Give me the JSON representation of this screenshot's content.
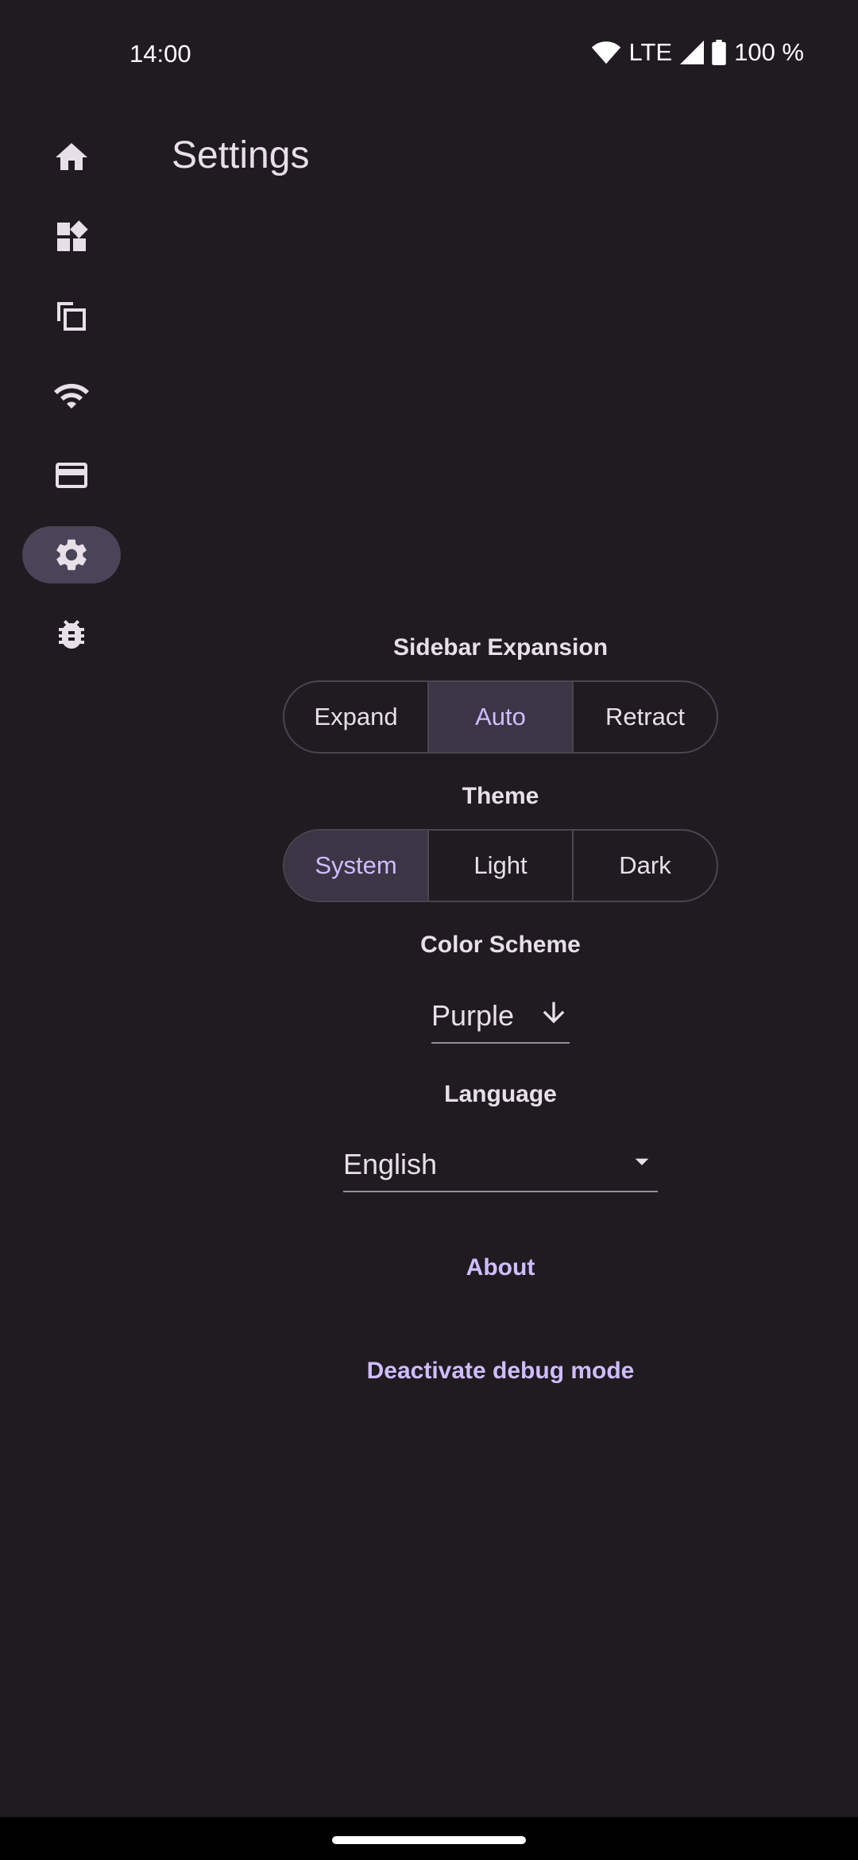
{
  "status_bar": {
    "time": "14:00",
    "network": "LTE",
    "battery": "100 %",
    "icons": [
      "wifi-icon",
      "cellular-signal-icon",
      "battery-icon"
    ]
  },
  "nav_rail": {
    "items": [
      {
        "name": "home",
        "icon": "home-icon",
        "active": false
      },
      {
        "name": "widgets",
        "icon": "widgets-icon",
        "active": false
      },
      {
        "name": "copy",
        "icon": "copy-icon",
        "active": false
      },
      {
        "name": "wifi",
        "icon": "wifi-icon",
        "active": false
      },
      {
        "name": "card",
        "icon": "credit-card-icon",
        "active": false
      },
      {
        "name": "settings",
        "icon": "gear-icon",
        "active": true
      },
      {
        "name": "debug",
        "icon": "bug-icon",
        "active": false
      }
    ]
  },
  "page": {
    "title": "Settings"
  },
  "sidebar_expansion": {
    "label": "Sidebar Expansion",
    "options": [
      "Expand",
      "Auto",
      "Retract"
    ],
    "selected": "Auto"
  },
  "theme": {
    "label": "Theme",
    "options": [
      "System",
      "Light",
      "Dark"
    ],
    "selected": "System"
  },
  "color_scheme": {
    "label": "Color Scheme",
    "value": "Purple",
    "icon": "arrow-down-icon"
  },
  "language": {
    "label": "Language",
    "value": "English",
    "icon": "dropdown-triangle-icon"
  },
  "actions": {
    "about": "About",
    "debug": "Deactivate debug mode"
  },
  "colors": {
    "background": "#1f1b20",
    "accent": "#d0bcff",
    "selected_segment": "#3b3545",
    "nav_active": "#4a4458"
  }
}
